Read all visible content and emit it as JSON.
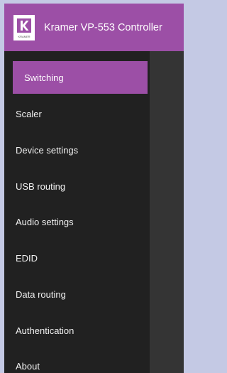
{
  "header": {
    "title": "Kramer VP-553 Controller",
    "logo_letter": "K",
    "logo_text": "KRAMER",
    "color": "#9c4fa6"
  },
  "sidebar": {
    "active_color": "#9c4fa6",
    "items": [
      {
        "label": "Switching",
        "active": true
      },
      {
        "label": "Scaler",
        "active": false
      },
      {
        "label": "Device settings",
        "active": false
      },
      {
        "label": "USB routing",
        "active": false
      },
      {
        "label": "Audio settings",
        "active": false
      },
      {
        "label": "EDID",
        "active": false
      },
      {
        "label": "Data routing",
        "active": false
      },
      {
        "label": "Authentication",
        "active": false
      },
      {
        "label": "About",
        "active": false
      }
    ]
  }
}
